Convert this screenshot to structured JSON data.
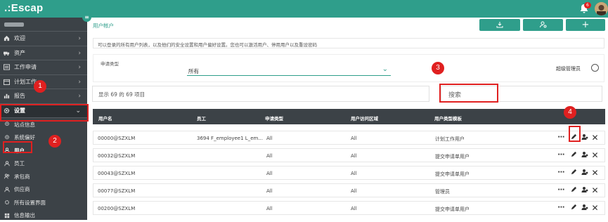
{
  "app": {
    "logo": ".:Escap",
    "notification_count": "6"
  },
  "sidebar": {
    "items": [
      {
        "label": "欢迎",
        "icon": "home-icon"
      },
      {
        "label": "资产",
        "icon": "truck-icon"
      },
      {
        "label": "工作申请",
        "icon": "list-icon"
      },
      {
        "label": "计划工作",
        "icon": "calendar-icon"
      },
      {
        "label": "报告",
        "icon": "chart-icon"
      },
      {
        "label": "设置",
        "icon": "gear-icon"
      }
    ],
    "sub_items": [
      {
        "label": "站点信息",
        "icon": "pin-icon"
      },
      {
        "label": "系统偏好",
        "icon": "pin-icon"
      },
      {
        "label": "用户",
        "icon": "user-icon"
      },
      {
        "label": "员工",
        "icon": "user-icon"
      },
      {
        "label": "承包商",
        "icon": "users-icon"
      },
      {
        "label": "供应商",
        "icon": "user-icon"
      },
      {
        "label": "所有设置界面",
        "icon": "gear-icon"
      },
      {
        "label": "信息输出",
        "icon": "grid-icon"
      }
    ]
  },
  "header": {
    "breadcrumb": "用户帐户"
  },
  "toolbar": {
    "export_icon": "download-icon",
    "settings_icon": "user-gear-icon",
    "add_label": "+"
  },
  "description": "可以登录的所有用户列表，以及他们的安全设置和用户偏好设置。您也可以激活用户、停用用户以及重设密码",
  "filter": {
    "label": "申请类型",
    "value": "所有",
    "admin_label": "超级管理员"
  },
  "stats": "显示 69 的 69 项目",
  "search": {
    "placeholder": "搜索"
  },
  "table": {
    "headers": [
      "用户名",
      "员工",
      "申请类型",
      "用户访问区域",
      "用户类型模板"
    ],
    "rows": [
      {
        "username": "00000@SZXLM",
        "employee": "3694 F_employee1 L_em...",
        "request_type": "All",
        "access_area": "All",
        "template": "计划工作用户"
      },
      {
        "username": "00032@SZXLM",
        "employee": "",
        "request_type": "All",
        "access_area": "All",
        "template": "提交申请单用户"
      },
      {
        "username": "00043@SZXLM",
        "employee": "",
        "request_type": "All",
        "access_area": "All",
        "template": "提交申请单用户"
      },
      {
        "username": "00077@SZXLM",
        "employee": "",
        "request_type": "All",
        "access_area": "All",
        "template": "管理员"
      },
      {
        "username": "00200@SZXLM",
        "employee": "",
        "request_type": "All",
        "access_area": "All",
        "template": "提交申请单用户"
      }
    ]
  },
  "annotations": [
    "1",
    "2",
    "3",
    "4"
  ],
  "colors": {
    "brand": "#2f9e8b",
    "sidebar": "#3c4247",
    "highlight": "#e02020"
  }
}
